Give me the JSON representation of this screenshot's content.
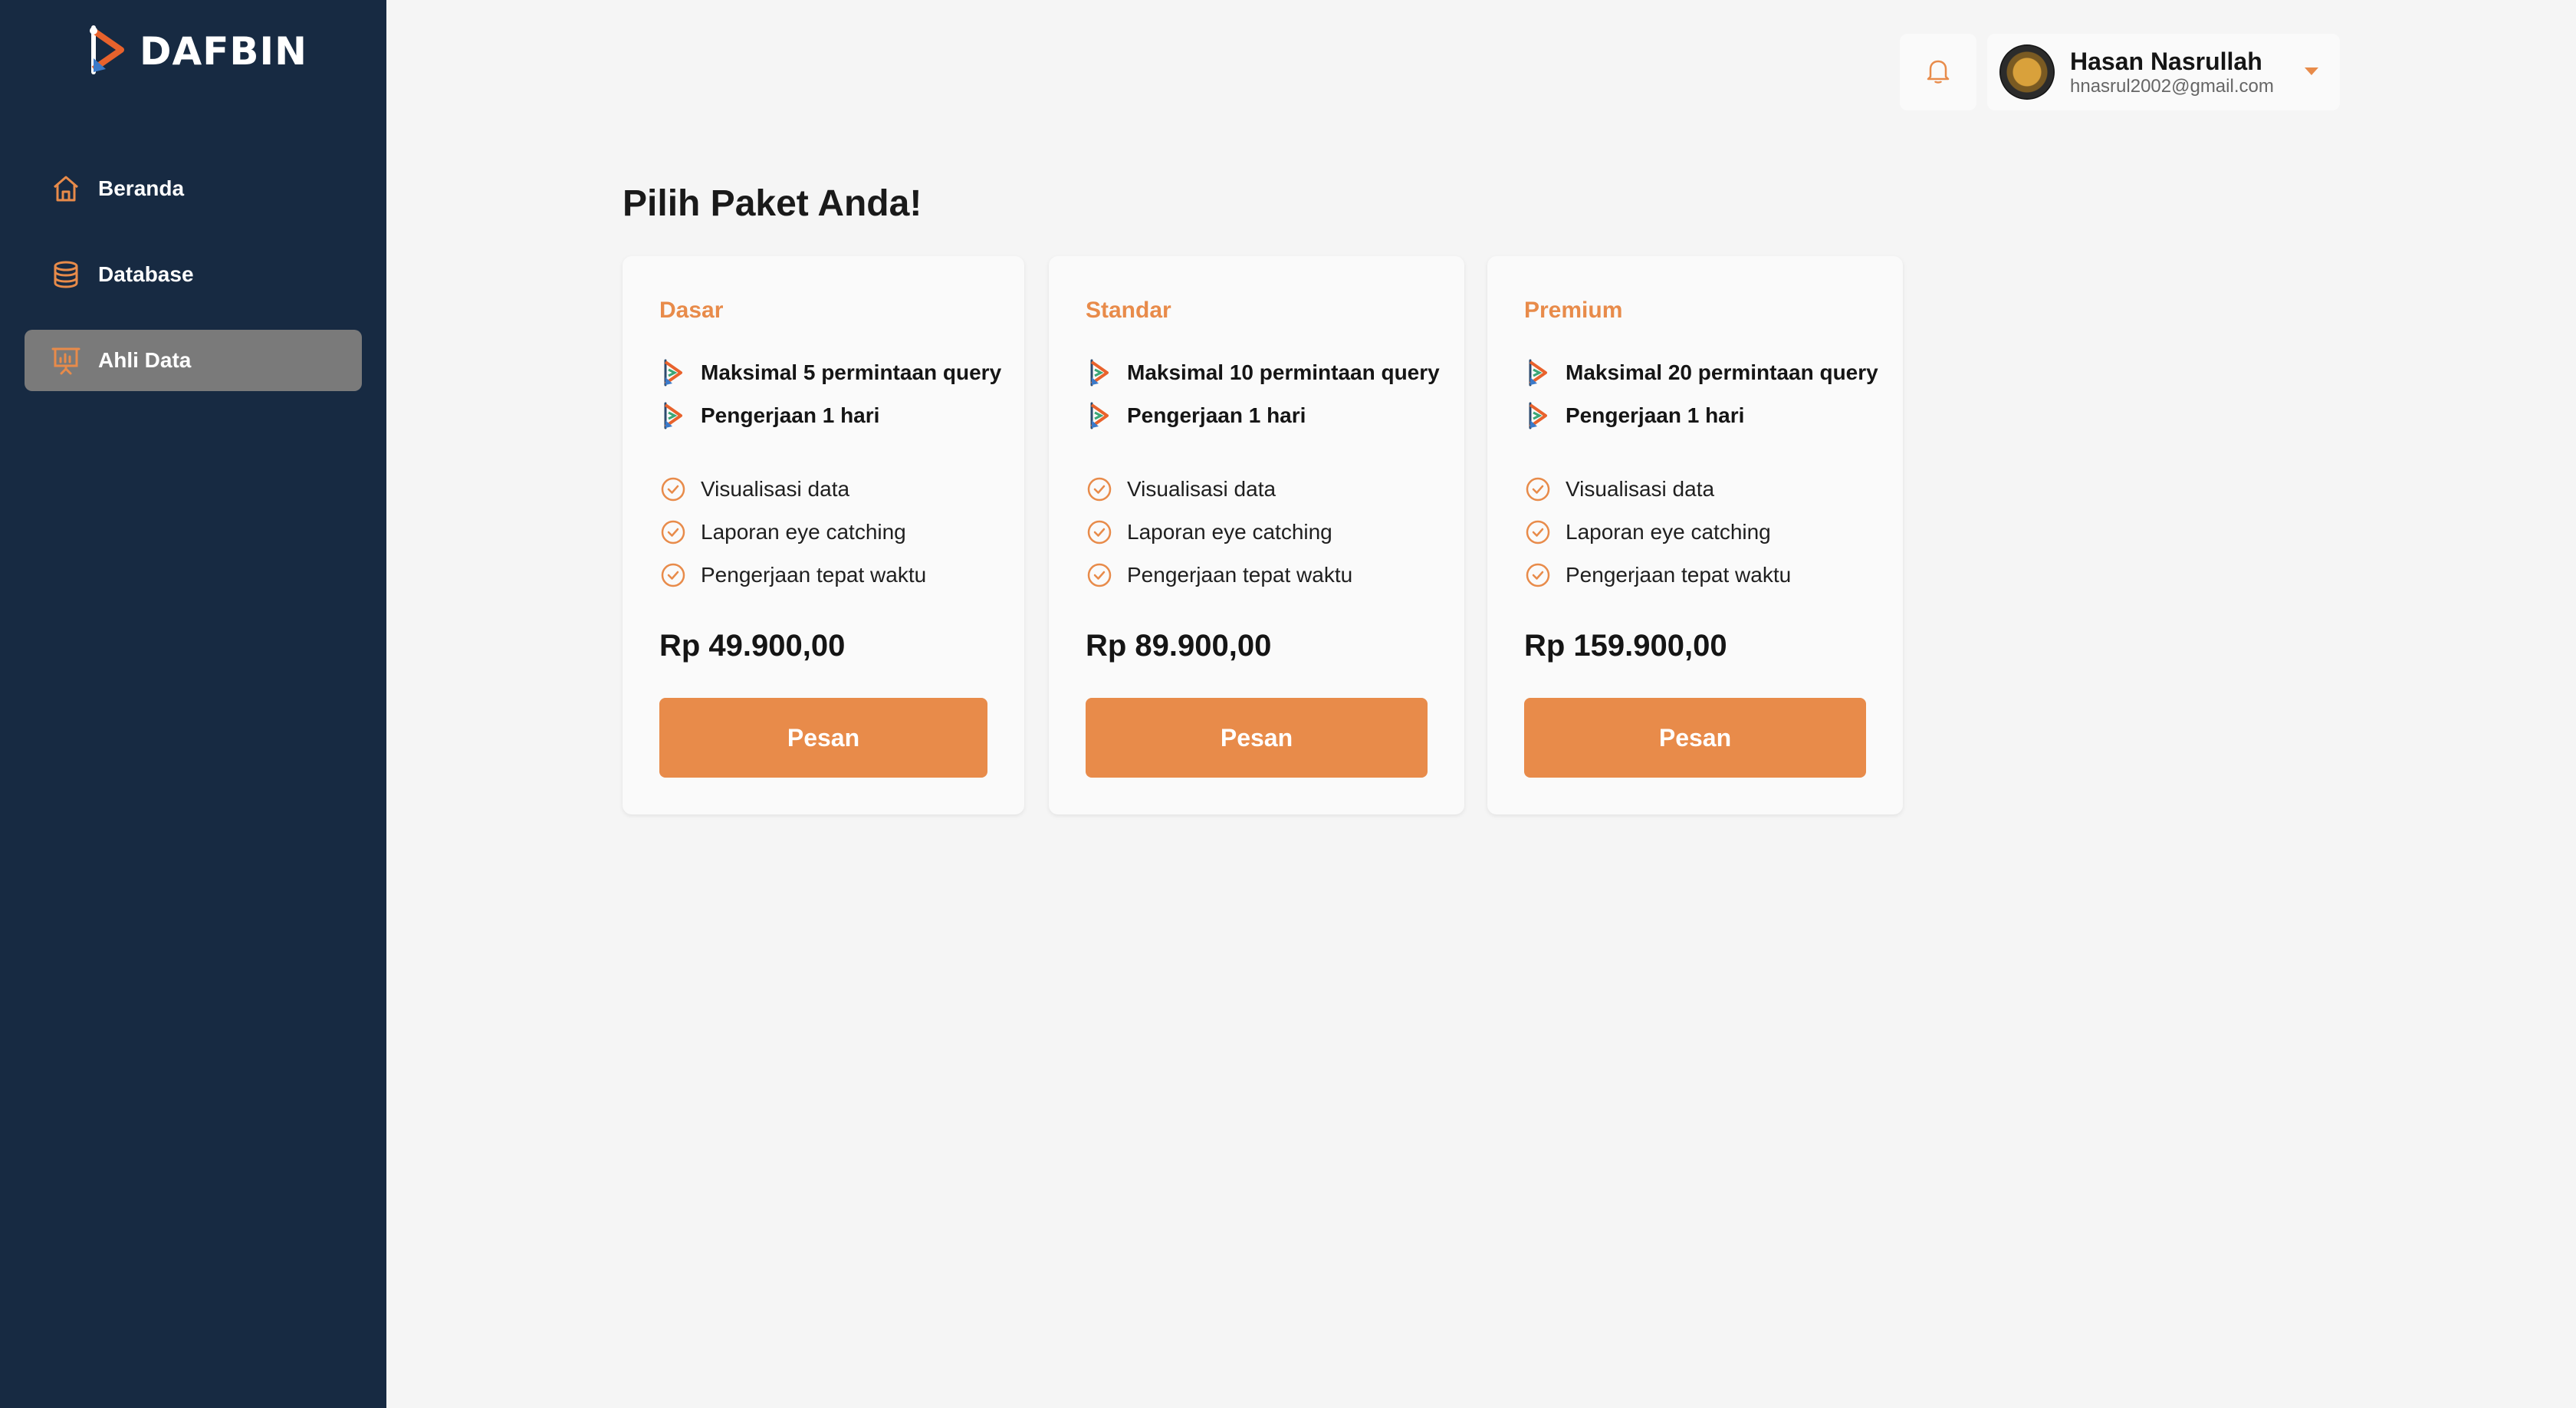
{
  "brand": {
    "name": "DAFBIN",
    "logo_icon": "dafbin-logo-icon"
  },
  "sidebar": {
    "items": [
      {
        "label": "Beranda",
        "icon": "home-icon",
        "active": false
      },
      {
        "label": "Database",
        "icon": "database-icon",
        "active": false
      },
      {
        "label": "Ahli Data",
        "icon": "presentation-chart-icon",
        "active": true
      }
    ]
  },
  "header": {
    "notification_icon": "bell-icon",
    "user": {
      "name": "Hasan Nasrullah",
      "email": "hnasrul2002@gmail.com"
    },
    "dropdown_icon": "caret-down-icon"
  },
  "main": {
    "title": "Pilih Paket Anda!",
    "plans": [
      {
        "name": "Dasar",
        "features_primary": [
          "Maksimal 5 permintaan query",
          "Pengerjaan 1 hari"
        ],
        "features_secondary": [
          "Visualisasi data",
          "Laporan eye catching",
          "Pengerjaan tepat waktu"
        ],
        "price": "Rp 49.900,00",
        "button": "Pesan"
      },
      {
        "name": "Standar",
        "features_primary": [
          "Maksimal 10 permintaan query",
          "Pengerjaan 1 hari"
        ],
        "features_secondary": [
          "Visualisasi data",
          "Laporan eye catching",
          "Pengerjaan tepat waktu"
        ],
        "price": "Rp 89.900,00",
        "button": "Pesan"
      },
      {
        "name": "Premium",
        "features_primary": [
          "Maksimal 20 permintaan query",
          "Pengerjaan 1 hari"
        ],
        "features_secondary": [
          "Visualisasi data",
          "Laporan eye catching",
          "Pengerjaan tepat waktu"
        ],
        "price": "Rp 159.900,00",
        "button": "Pesan"
      }
    ]
  },
  "colors": {
    "sidebar_bg": "#172a42",
    "accent": "#e88b4a",
    "active_nav_bg": "#7a7a7a",
    "page_bg": "#f5f5f5"
  }
}
